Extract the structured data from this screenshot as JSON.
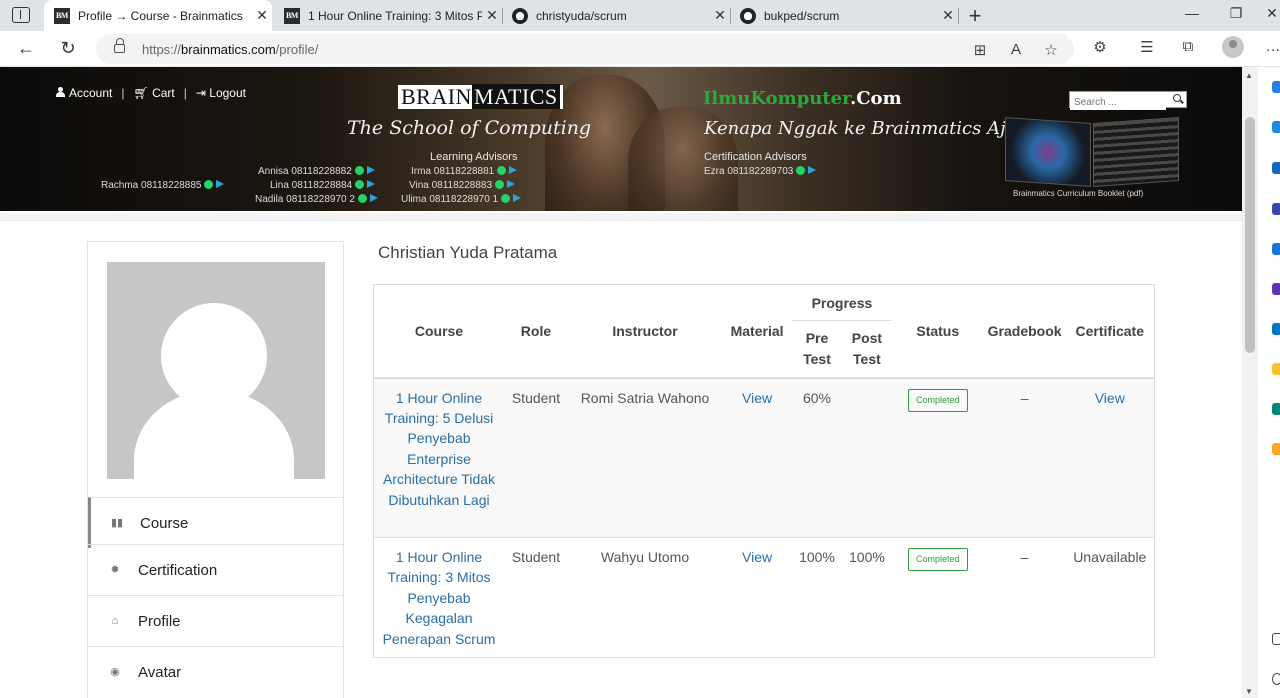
{
  "browser": {
    "tabs": [
      {
        "title": "Profile → Course - Brainmatics",
        "favicon": "brainmatics-icon",
        "active": true
      },
      {
        "title": "1 Hour Online Training: 3 Mitos P",
        "favicon": "brainmatics-icon",
        "active": false
      },
      {
        "title": "christyuda/scrum",
        "favicon": "github-icon",
        "active": false
      },
      {
        "title": "bukped/scrum",
        "favicon": "github-icon",
        "active": false
      }
    ],
    "favicon_text": "BM",
    "url_prefix": "https://",
    "url_host": "brainmatics.com",
    "url_path": "/profile/"
  },
  "banner": {
    "account": "Account",
    "cart": "Cart",
    "logout": "Logout",
    "sep": "|",
    "logo_brain": "BRAIN",
    "logo_matics": "MATICS",
    "tagline_left": "The School of Computing",
    "learning_advisors": "Learning Advisors",
    "advisors_left": [
      "Rachma  08118228885",
      "Annisa  08118228882",
      "Lina  08118228884",
      "Nadila  08118228970 2"
    ],
    "advisors_mid": [
      "Irma  08118228881",
      "Vina  08118228883",
      "Ulima  08118228970 1"
    ],
    "ilkom_green": "IlmuKomputer",
    "ilkom_white": ".Com",
    "tagline_right": "Kenapa Nggak ke Brainmatics Aja?",
    "cert_advisors": "Certification Advisors",
    "cert_contact": "Ezra  081182289703",
    "search_placeholder": "Search ...",
    "booklet_label": "Brainmatics Curriculum Booklet (pdf)"
  },
  "sidebar": {
    "items": [
      {
        "label": "Course",
        "icon": "book-icon",
        "active": true
      },
      {
        "label": "Certification",
        "icon": "certificate-icon",
        "active": false
      },
      {
        "label": "Profile",
        "icon": "home-icon",
        "active": false
      },
      {
        "label": "Avatar",
        "icon": "user-circle-icon",
        "active": false
      }
    ]
  },
  "profile": {
    "name": "Christian Yuda Pratama"
  },
  "table": {
    "headers": {
      "course": "Course",
      "role": "Role",
      "instructor": "Instructor",
      "material": "Material",
      "progress": "Progress",
      "pre_test": "Pre Test",
      "post_test": "Post Test",
      "status": "Status",
      "gradebook": "Gradebook",
      "certificate": "Certificate"
    },
    "rows": [
      {
        "course": "1 Hour Online Training: 5 Delusi Penyebab Enterprise Architecture Tidak Dibutuhkan Lagi",
        "role": "Student",
        "instructor": "Romi Satria Wahono",
        "material": "View",
        "pre_test": "60%",
        "post_test": "",
        "status": "Completed",
        "gradebook": "–",
        "certificate": "View"
      },
      {
        "course": "1 Hour Online Training: 3 Mitos Penyebab Kegagalan Penerapan Scrum",
        "role": "Student",
        "instructor": "Wahyu Utomo",
        "material": "View",
        "pre_test": "100%",
        "post_test": "100%",
        "status": "Completed",
        "gradebook": "–",
        "certificate": "Unavailable"
      }
    ]
  },
  "colors": {
    "link": "#2a6ea8",
    "completed": "#2e9d3b"
  }
}
